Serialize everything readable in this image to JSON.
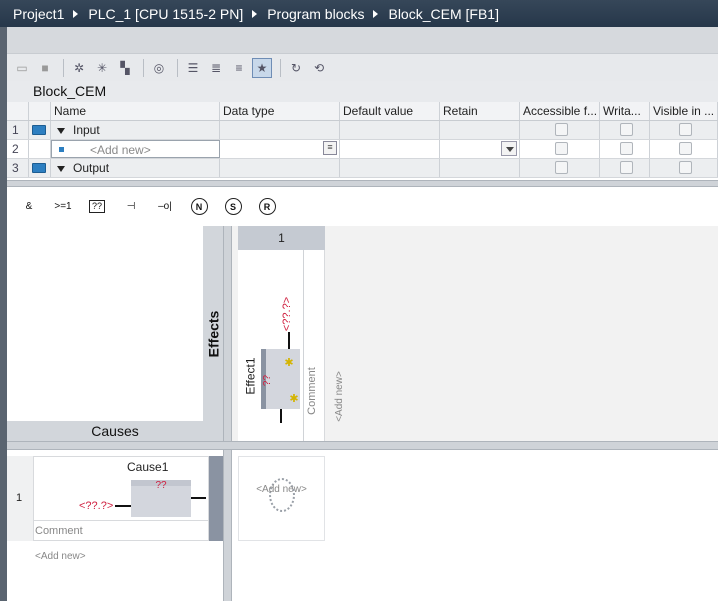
{
  "breadcrumb": [
    "Project1",
    "PLC_1 [CPU 1515-2 PN]",
    "Program blocks",
    "Block_CEM [FB1]"
  ],
  "block_title": "Block_CEM",
  "interface": {
    "columns": [
      "Name",
      "Data type",
      "Default value",
      "Retain",
      "Accessible f...",
      "Writa...",
      "Visible in ..."
    ],
    "rows": [
      {
        "num": "1",
        "name": "Input",
        "kind": "section"
      },
      {
        "num": "2",
        "name": "<Add new>",
        "kind": "add"
      },
      {
        "num": "3",
        "name": "Output",
        "kind": "section"
      }
    ]
  },
  "palette": {
    "and_label": "&",
    "or_label": ">=1",
    "box_label": "??",
    "n_label": "N",
    "s_label": "S",
    "r_label": "R"
  },
  "cem": {
    "causes_label": "Causes",
    "effects_label": "Effects",
    "effect_column_number": "1",
    "effect": {
      "title": "Effect1",
      "instruction": "??",
      "operand": "<??.?>",
      "comment": "Comment",
      "add_new": "<Add new>"
    },
    "cause": {
      "row_number": "1",
      "title": "Cause1",
      "instruction": "??",
      "operand": "<??.?>",
      "comment": "Comment",
      "add_new": "<Add new>"
    },
    "matrix_add_new": "<Add new>"
  }
}
